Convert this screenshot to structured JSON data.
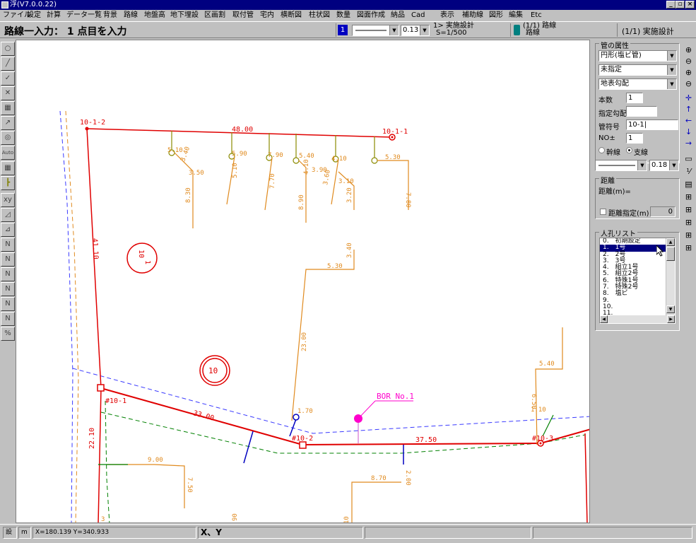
{
  "window": {
    "title": "浮(V7.0.0.22)",
    "controls": [
      "_",
      "▫",
      "×"
    ]
  },
  "menu": [
    "ファイル",
    "設定",
    "計算",
    "データ一覧",
    "背景",
    "路線",
    "地盤高",
    "地下埋設",
    "区画割",
    "取付管",
    "宅内",
    "横断図",
    "柱状図",
    "数量",
    "図面作成",
    "納品",
    "Cad",
    "表示",
    "補助線",
    "図形",
    "編集",
    "Etc"
  ],
  "modebar": {
    "mode_label": "路線一入力： 1 点目を入力",
    "layer_number": "1",
    "line_width": "0.13",
    "design_title": "1> 実施設計",
    "scale": "S=1/500",
    "route_title": "(1/1) 路線",
    "route_sub": "路線",
    "design_right": "(1/1) 実施設計"
  },
  "panel": {
    "pipe_attr_title": "管の属性",
    "pipe_type": "円形(塩ビ管)",
    "unspecified": "未指定",
    "gradient_mode": "地表勾配",
    "count_label": "本数",
    "count_value": "1",
    "spec_grad_label": "指定勾配",
    "spec_grad_value": "",
    "pipe_no_label": "管符号",
    "pipe_no_value": "10-1|",
    "no_pm_label": "NO±",
    "no_pm_value": "1",
    "radio_main": "幹線",
    "radio_branch": "支線",
    "line_width_value": "0.18 n",
    "distance_title": "距離",
    "distance_label": "距離(m)=",
    "distance_check": "距離指定(m)",
    "distance_value": "0",
    "manhole_title": "人孔リスト",
    "manholes": [
      "0.　初期設定",
      "1.　1号",
      "2.　2号",
      "3.　3号",
      "4.　組立1号",
      "5.　組立2号",
      "6.　特殊1号",
      "7.　特殊2号",
      "8.　塩ビ",
      "9.",
      "10.",
      "11."
    ],
    "selected_manhole": 1
  },
  "left_tools": [
    "○",
    "╱",
    "✓",
    "✕",
    "▦",
    "↗",
    "◎",
    "Auto",
    "▦",
    "┣",
    "xy",
    "◿",
    "⊿",
    "N",
    "N",
    "N",
    "N",
    "N",
    "N",
    "%"
  ],
  "right_tools": [
    "⊕",
    "⊖",
    "⊕",
    "⊖",
    "✛",
    "↑",
    "←",
    "↓",
    "→",
    "▭",
    "⅟",
    "▤",
    "⊞",
    "⊞",
    "⊞",
    "⊞",
    "⊞"
  ],
  "status": {
    "cell1": "設",
    "cell2": "m",
    "coords": "X=180.139 Y=340.933",
    "prompt": "X、Y"
  },
  "drawing": {
    "node_labels": {
      "n1": "10-1-2",
      "n2": "10-1-1",
      "n3": "#10-1",
      "n4": "#10-2",
      "n5": "#10-3"
    },
    "route_lengths": {
      "top": "48.00",
      "left": "41.10",
      "bottom1": "33.00",
      "bottom2": "37.50",
      "left_low": "22.10"
    },
    "block_labels": {
      "b1_top": "10",
      "b1_bottom": "1",
      "b2": "10"
    },
    "bor_label": "BOR No.1",
    "branch_labels": [
      "5.10",
      "3.40",
      "3.50",
      "8.30",
      "5.90",
      "5.10",
      "7.90",
      "7.70",
      "5.40",
      "4.10",
      "3.90",
      "8.90",
      "4.10",
      "3.60",
      "3.10",
      "3.20",
      "5.30",
      "7.80",
      "3.40",
      "5.30",
      "23.00",
      "1.70",
      "5.40",
      "6.50",
      "1.10",
      "9.00",
      "7.50",
      "8.70",
      "2.00",
      "90",
      "10",
      "3"
    ]
  },
  "colors": {
    "route": "#e00000",
    "branch": "#e08a1e",
    "olive": "#8a8a00",
    "blue": "#0000c0",
    "magenta": "#ff00cc",
    "green": "#008000",
    "selection": "#000080"
  }
}
